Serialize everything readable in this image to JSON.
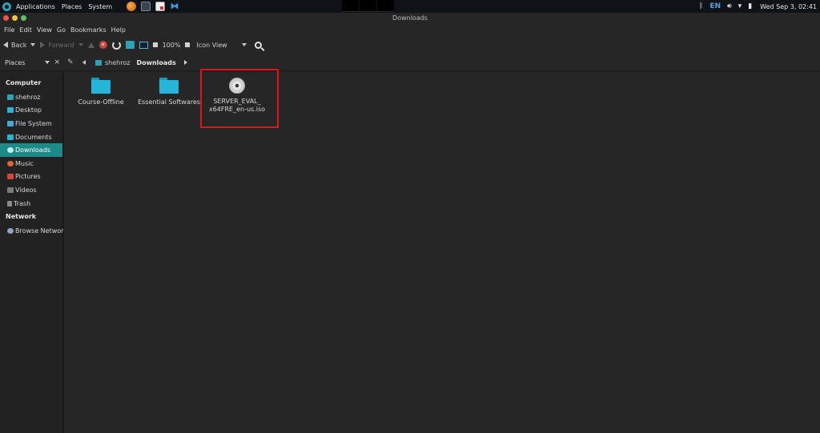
{
  "panel": {
    "menus": [
      "Applications",
      "Places",
      "System"
    ],
    "launchers": [
      "firefox-icon",
      "terminal-icon",
      "text-editor-icon",
      "vscode-icon"
    ],
    "tray": {
      "keyboard_layout": "EN"
    },
    "clock": "Wed Sep  3, 02:41"
  },
  "window": {
    "title": "Downloads"
  },
  "menubar": {
    "items": [
      "File",
      "Edit",
      "View",
      "Go",
      "Bookmarks",
      "Help"
    ]
  },
  "toolbar": {
    "back_label": "Back",
    "forward_label": "Forward",
    "zoom": "100%",
    "view_mode": "Icon View"
  },
  "location": {
    "side_pane_label": "Places",
    "close_symbol": "×",
    "breadcrumbs": [
      "shehroz",
      "Downloads"
    ]
  },
  "sidebar": {
    "sections": [
      {
        "heading": "Computer",
        "items": [
          "shehroz",
          "Desktop",
          "File System",
          "Documents",
          "Downloads",
          "Music",
          "Pictures",
          "Videos",
          "Trash"
        ]
      },
      {
        "heading": "Network",
        "items": [
          "Browse Network"
        ]
      }
    ],
    "active_item": "Downloads"
  },
  "files": [
    {
      "name": "Course-Offline",
      "type": "folder"
    },
    {
      "name": "Essential Softwares",
      "type": "folder"
    },
    {
      "name_line1": "SERVER_EVAL_",
      "name_line2": "x64FRE_en-us.iso",
      "type": "disc-image"
    }
  ],
  "colors": {
    "accent": "#1c8a87",
    "folder": "#26b5d8",
    "highlight": "#e0141b"
  }
}
